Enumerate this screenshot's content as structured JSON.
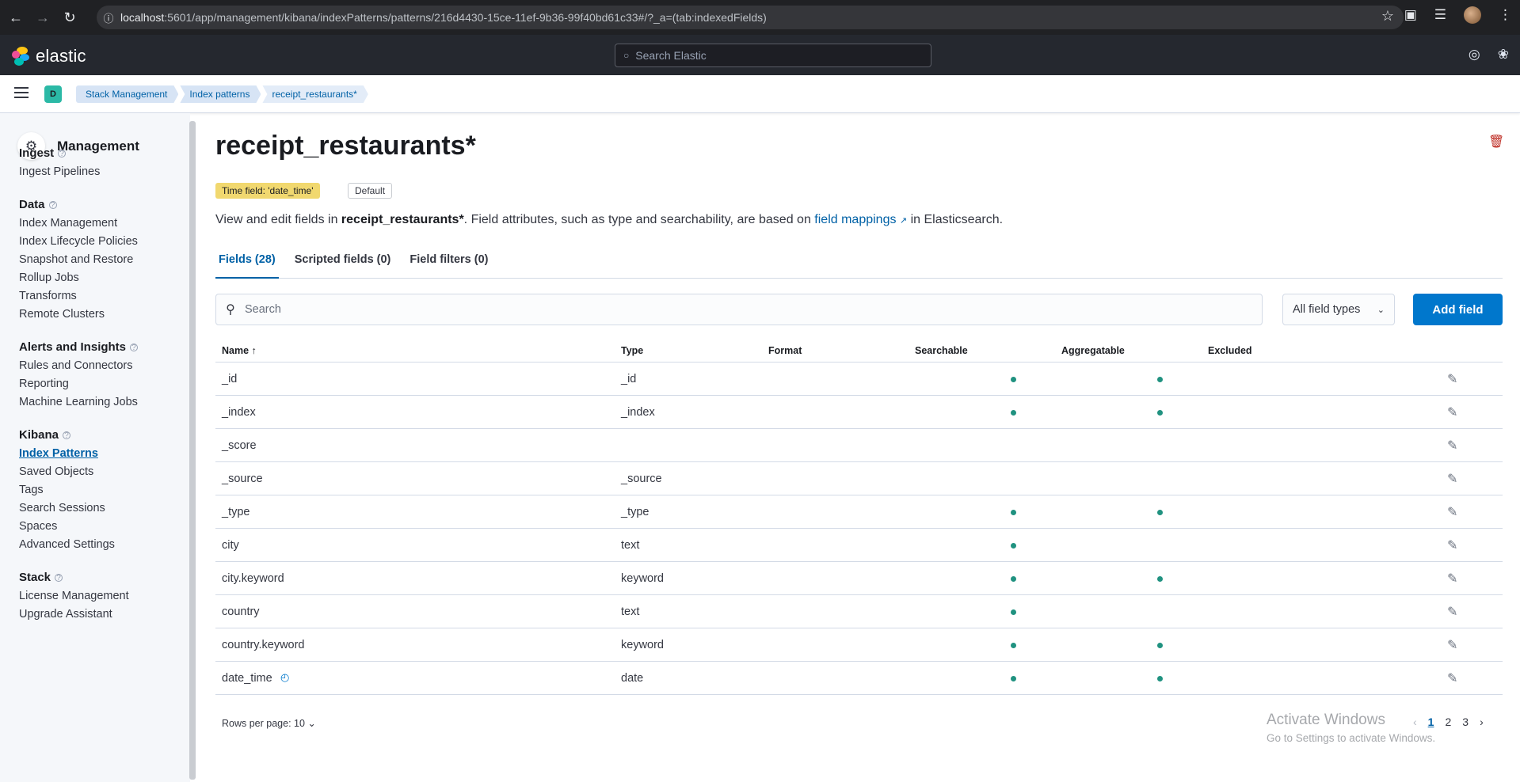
{
  "browser": {
    "url_host": "localhost",
    "url_rest": ":5601/app/management/kibana/indexPatterns/patterns/216d4430-15ce-11ef-9b36-99f40bd61c33#/?_a=(tab:indexedFields)"
  },
  "header": {
    "logo_text": "elastic",
    "search_placeholder": "Search Elastic"
  },
  "breadcrumbs": {
    "space_letter": "D",
    "items": [
      "Stack Management",
      "Index patterns",
      "receipt_restaurants*"
    ]
  },
  "sidebar": {
    "title": "Management",
    "groups": [
      {
        "label": "Ingest",
        "items": [
          "Ingest Pipelines"
        ]
      },
      {
        "label": "Data",
        "items": [
          "Index Management",
          "Index Lifecycle Policies",
          "Snapshot and Restore",
          "Rollup Jobs",
          "Transforms",
          "Remote Clusters"
        ]
      },
      {
        "label": "Alerts and Insights",
        "items": [
          "Rules and Connectors",
          "Reporting",
          "Machine Learning Jobs"
        ]
      },
      {
        "label": "Kibana",
        "items": [
          "Index Patterns",
          "Saved Objects",
          "Tags",
          "Search Sessions",
          "Spaces",
          "Advanced Settings"
        ]
      },
      {
        "label": "Stack",
        "items": [
          "License Management",
          "Upgrade Assistant"
        ]
      }
    ]
  },
  "main": {
    "title": "receipt_restaurants*",
    "time_badge": "Time field: 'date_time'",
    "default_badge": "Default",
    "desc_pre": "View and edit fields in ",
    "desc_bold": "receipt_restaurants*",
    "desc_mid": ". Field attributes, such as type and searchability, are based on ",
    "desc_link": "field mappings",
    "desc_post": " in Elasticsearch.",
    "tabs": [
      "Fields (28)",
      "Scripted fields (0)",
      "Field filters (0)"
    ],
    "search_placeholder": "Search",
    "field_types": "All field types",
    "add_field": "Add field"
  },
  "table": {
    "headers": {
      "name": "Name",
      "type": "Type",
      "format": "Format",
      "searchable": "Searchable",
      "aggregatable": "Aggregatable",
      "excluded": "Excluded"
    },
    "rows": [
      {
        "name": "_id",
        "type": "_id",
        "searchable": true,
        "aggregatable": true
      },
      {
        "name": "_index",
        "type": "_index",
        "searchable": true,
        "aggregatable": true
      },
      {
        "name": "_score",
        "type": "",
        "searchable": false,
        "aggregatable": false
      },
      {
        "name": "_source",
        "type": "_source",
        "searchable": false,
        "aggregatable": false
      },
      {
        "name": "_type",
        "type": "_type",
        "searchable": true,
        "aggregatable": true
      },
      {
        "name": "city",
        "type": "text",
        "searchable": true,
        "aggregatable": false
      },
      {
        "name": "city.keyword",
        "type": "keyword",
        "searchable": true,
        "aggregatable": true
      },
      {
        "name": "country",
        "type": "text",
        "searchable": true,
        "aggregatable": false
      },
      {
        "name": "country.keyword",
        "type": "keyword",
        "searchable": true,
        "aggregatable": true
      },
      {
        "name": "date_time",
        "type": "date",
        "searchable": true,
        "aggregatable": true,
        "time_field": true
      }
    ],
    "rows_per_page": "Rows per page: 10",
    "pages": [
      "1",
      "2",
      "3"
    ]
  },
  "watermark": {
    "line1": "Activate Windows",
    "line2": "Go to Settings to activate Windows."
  }
}
